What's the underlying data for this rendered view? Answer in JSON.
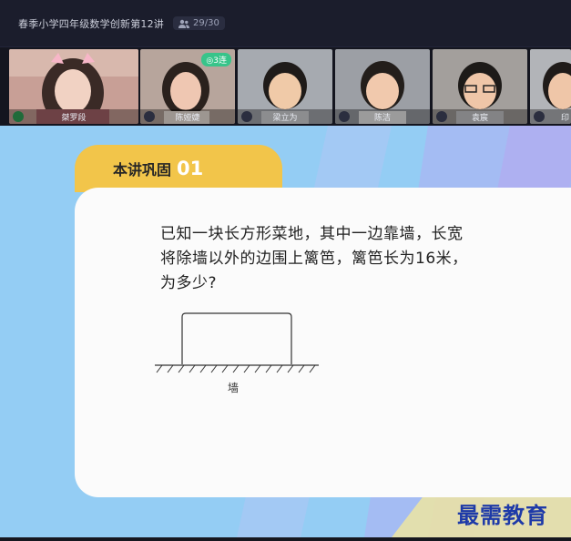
{
  "header": {
    "course_title": "春季小学四年级数学创新第12讲",
    "attendance": "29/30"
  },
  "participants": [
    {
      "name": "桀罗段",
      "role": "teacher",
      "mic_active": true,
      "badge": ""
    },
    {
      "name": "陈娅婕",
      "role": "student",
      "mic_active": false,
      "badge": "3连"
    },
    {
      "name": "梁立为",
      "role": "student",
      "mic_active": false,
      "badge": ""
    },
    {
      "name": "陈洁",
      "role": "student",
      "mic_active": false,
      "badge": ""
    },
    {
      "name": "袁宸",
      "role": "student",
      "mic_active": false,
      "badge": ""
    },
    {
      "name": "印",
      "role": "student",
      "mic_active": false,
      "badge": ""
    }
  ],
  "slide": {
    "tab_title": "本讲巩固",
    "tab_number": "01",
    "problem_text": "已知一块长方形菜地，其中一边靠墙，长宽\n将除墙以外的边围上篱笆，篱笆长为16米，\n为多少?",
    "wall_label": "墙"
  },
  "watermark": "最需教育",
  "colors": {
    "board_bg": "#94cdf4",
    "tab_yellow": "#f2c54a",
    "badge_green": "#38c48a",
    "watermark_blue": "#1e3aa8"
  }
}
